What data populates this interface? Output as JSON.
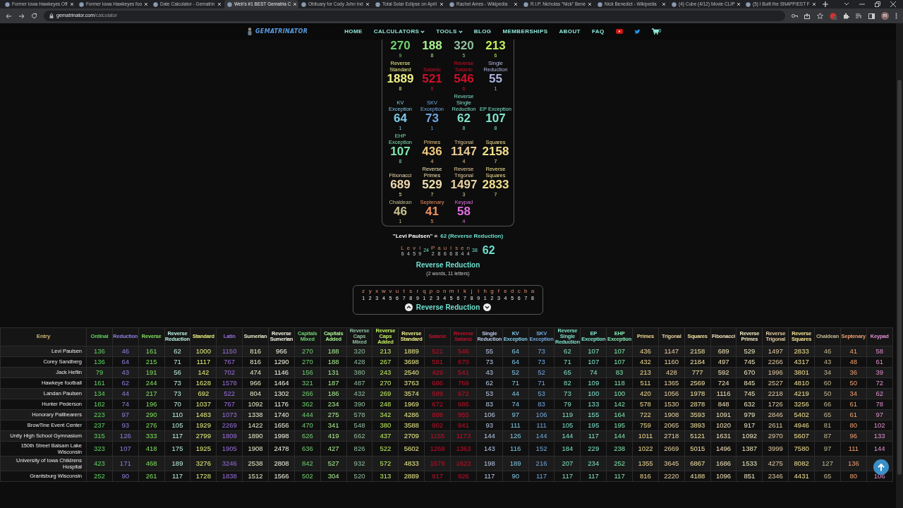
{
  "browser": {
    "tabs": [
      {
        "title": "Former Iowa Hawkeyes Off",
        "selected": false
      },
      {
        "title": "Former Iowa Hawkeyes foo",
        "selected": false
      },
      {
        "title": "Date Calculator - Gematrin",
        "selected": false
      },
      {
        "title": "Web's #1 BEST Gematria C",
        "selected": true
      },
      {
        "title": "Obituary for Cody John Ind",
        "selected": false
      },
      {
        "title": "Total Solar Eclipse on April",
        "selected": false
      },
      {
        "title": "Rachel Ames - Wikipedia",
        "selected": false
      },
      {
        "title": "R.I.P. Nicholas \"Nick\" Bene",
        "selected": false
      },
      {
        "title": "Nick Benedict - Wikipedia",
        "selected": false
      },
      {
        "title": "(4) Cube (4/12) Movie CLIP",
        "selected": false
      },
      {
        "title": "(5) I Built the SNAPPIEST F",
        "selected": false
      }
    ],
    "address_host": "gematrinator.com",
    "address_path": "/calculator",
    "profile_initial": "m"
  },
  "site_nav": {
    "logo": "GEMATRINATOR",
    "links": [
      {
        "label": "HOME",
        "dropdown": false
      },
      {
        "label": "CALCULATORS",
        "dropdown": true
      },
      {
        "label": "TOOLS",
        "dropdown": true
      },
      {
        "label": "BLOG",
        "dropdown": false
      },
      {
        "label": "MEMBERSHIPS",
        "dropdown": false
      },
      {
        "label": "ABOUT",
        "dropdown": false
      },
      {
        "label": "FAQ",
        "dropdown": false
      }
    ],
    "cart_count": "0"
  },
  "cipher_grid": {
    "rows": [
      [
        {
          "value": "270",
          "digit": "9",
          "color": "#6fcf6f"
        },
        {
          "value": "188",
          "digit": "8",
          "color": "#a8f08f"
        },
        {
          "value": "320",
          "digit": "5",
          "color": "#8fbf9f"
        },
        {
          "value": "213",
          "digit": "6",
          "color": "#c0f060"
        }
      ],
      [
        {
          "label": "Reverse Standard",
          "value": "1889",
          "digit": "8",
          "color": "#f0f08a"
        },
        {
          "label": "Satanic",
          "value": "521",
          "digit": "8",
          "color": "#d0102a"
        },
        {
          "label": "Reverse Satanic",
          "value": "546",
          "digit": "6",
          "color": "#d0102a"
        },
        {
          "label": "Single Reduction",
          "value": "55",
          "digit": "1",
          "color": "#b0b8e0"
        }
      ],
      [
        {
          "label": "KV Exception",
          "value": "64",
          "digit": "1",
          "color": "#7fc8e8"
        },
        {
          "label": "SKV Exception",
          "value": "73",
          "digit": "1",
          "color": "#6fa8e0"
        },
        {
          "label": "Reverse Single Reduction",
          "value": "62",
          "digit": "8",
          "color": "#7fe0c8"
        },
        {
          "label": "EP Exception",
          "value": "107",
          "digit": "8",
          "color": "#7fe8d0"
        }
      ],
      [
        {
          "label": "EHP Exception",
          "value": "107",
          "digit": "8",
          "color": "#7fe8b0"
        },
        {
          "label": "Primes",
          "value": "436",
          "digit": "4",
          "color": "#f0c880"
        },
        {
          "label": "Trigonal",
          "value": "1147",
          "digit": "4",
          "color": "#e8c898"
        },
        {
          "label": "Squares",
          "value": "2158",
          "digit": "7",
          "color": "#f0e090"
        }
      ],
      [
        {
          "label": "Fibonacci",
          "value": "689",
          "digit": "5",
          "color": "#f0d8b0"
        },
        {
          "label": "Reverse Primes",
          "value": "529",
          "digit": "7",
          "color": "#f0e0b0"
        },
        {
          "label": "Reverse Trigonal",
          "value": "1497",
          "digit": "3",
          "color": "#e8d0a0"
        },
        {
          "label": "Reverse Squares",
          "value": "2833",
          "digit": "7",
          "color": "#f0e090"
        }
      ],
      [
        {
          "label": "Chaldean",
          "value": "46",
          "digit": "1",
          "color": "#c8c090"
        },
        {
          "label": "Septenary",
          "value": "41",
          "digit": "5",
          "color": "#f09060"
        },
        {
          "label": "Keypad",
          "value": "58",
          "digit": "4",
          "color": "#e070e0"
        }
      ]
    ]
  },
  "summary": {
    "phrase": "\"Levi Paulsen\" =",
    "result": "62 (Reverse Reduction)",
    "words": [
      {
        "letters": [
          {
            "letter": "L",
            "value": "6"
          },
          {
            "letter": "e",
            "value": "4"
          },
          {
            "letter": "v",
            "value": "5"
          },
          {
            "letter": "i",
            "value": "9"
          }
        ],
        "total": "24"
      },
      {
        "letters": [
          {
            "letter": "P",
            "value": "2"
          },
          {
            "letter": "a",
            "value": "8"
          },
          {
            "letter": "u",
            "value": "6"
          },
          {
            "letter": "l",
            "value": "6"
          },
          {
            "letter": "s",
            "value": "8"
          },
          {
            "letter": "e",
            "value": "4"
          },
          {
            "letter": "n",
            "value": "4"
          }
        ],
        "total": "38"
      }
    ],
    "grand_total": "62",
    "cipher": "Reverse Reduction",
    "counts": "(2 words, 11 letters)"
  },
  "cipher_key": {
    "letters": [
      "z",
      "y",
      "x",
      "w",
      "v",
      "u",
      "t",
      "s",
      "r",
      "q",
      "p",
      "o",
      "n",
      "m",
      "l",
      "k",
      "j",
      "i",
      "h",
      "g",
      "f",
      "e",
      "d",
      "c",
      "b",
      "a"
    ],
    "numbers": [
      "1",
      "2",
      "3",
      "4",
      "5",
      "6",
      "7",
      "8",
      "9",
      "1",
      "2",
      "3",
      "4",
      "5",
      "6",
      "7",
      "8",
      "9",
      "1",
      "2",
      "3",
      "4",
      "5",
      "6",
      "7",
      "8"
    ],
    "label": "Reverse Reduction"
  },
  "table": {
    "columns": [
      {
        "label": "Entry",
        "color": "#c8b46e"
      },
      {
        "label": "Ordinal",
        "color": "#5fd35f"
      },
      {
        "label": "Reduction",
        "color": "#8f7fdf"
      },
      {
        "label": "Reverse",
        "color": "#7fe05f"
      },
      {
        "label": "Reverse Reduction",
        "color": "#b8f0e0"
      },
      {
        "label": "Standard",
        "color": "#e8f07a"
      },
      {
        "label": "Latin",
        "color": "#9a6fe0"
      },
      {
        "label": "Sumerian",
        "color": "#e8e8c8"
      },
      {
        "label": "Reverse Sumerian",
        "color": "#f4f4e4"
      },
      {
        "label": "Capitals Mixed",
        "color": "#6fcf6f"
      },
      {
        "label": "Capitals Added",
        "color": "#a8f08f"
      },
      {
        "label": "Reverse Caps Mixed",
        "color": "#8fbf9f"
      },
      {
        "label": "Reverse Caps Added",
        "color": "#c0f060"
      },
      {
        "label": "Reverse Standard",
        "color": "#f0f08a"
      },
      {
        "label": "Satanic",
        "color": "#c0102a"
      },
      {
        "label": "Reverse Satanic",
        "color": "#c0102a"
      },
      {
        "label": "Single Reduction",
        "color": "#b8c8e8"
      },
      {
        "label": "KV Exception",
        "color": "#7fc8e8"
      },
      {
        "label": "SKV Exception",
        "color": "#6fa8e0"
      },
      {
        "label": "Reverse Single Reduction",
        "color": "#7fe0c8"
      },
      {
        "label": "EP Exception",
        "color": "#7fe8d0"
      },
      {
        "label": "EHP Exception",
        "color": "#7fe8b0"
      },
      {
        "label": "Primes",
        "color": "#f0d890"
      },
      {
        "label": "Trigonal",
        "color": "#e8d0a0"
      },
      {
        "label": "Squares",
        "color": "#f0e0a0"
      },
      {
        "label": "Fibonacci",
        "color": "#f0e0b8"
      },
      {
        "label": "Reverse Primes",
        "color": "#f0e8c0"
      },
      {
        "label": "Reverse Trigonal",
        "color": "#e0c8a0"
      },
      {
        "label": "Reverse Squares",
        "color": "#f0e090"
      },
      {
        "label": "Chaldean",
        "color": "#c0b890"
      },
      {
        "label": "Septenary",
        "color": "#f0a070"
      },
      {
        "label": "Keypad",
        "color": "#e090d0"
      }
    ],
    "rows": [
      {
        "entry": "Levi Paulsen",
        "values": [
          "136",
          "46",
          "161",
          "62",
          "1000",
          "1150",
          "816",
          "966",
          "270",
          "188",
          "320",
          "213",
          "1889",
          "521",
          "546",
          "55",
          "64",
          "73",
          "62",
          "107",
          "107",
          "436",
          "1147",
          "2158",
          "689",
          "529",
          "1497",
          "2833",
          "46",
          "41",
          "58"
        ]
      },
      {
        "entry": "Corey Sandberg",
        "values": [
          "136",
          "64",
          "215",
          "71",
          "1117",
          "767",
          "816",
          "1290",
          "270",
          "188",
          "428",
          "267",
          "3698",
          "591",
          "670",
          "73",
          "64",
          "73",
          "71",
          "107",
          "107",
          "432",
          "1160",
          "2184",
          "497",
          "745",
          "2266",
          "4317",
          "43",
          "48",
          "61"
        ]
      },
      {
        "entry": "Jack Heflin",
        "values": [
          "79",
          "43",
          "191",
          "56",
          "142",
          "702",
          "474",
          "1146",
          "156",
          "131",
          "380",
          "243",
          "2540",
          "429",
          "541",
          "43",
          "52",
          "52",
          "65",
          "74",
          "83",
          "213",
          "428",
          "777",
          "592",
          "670",
          "1996",
          "3801",
          "34",
          "36",
          "39"
        ]
      },
      {
        "entry": "Hawkeye football",
        "values": [
          "161",
          "62",
          "244",
          "73",
          "1628",
          "1578",
          "966",
          "1464",
          "321",
          "187",
          "487",
          "270",
          "3763",
          "686",
          "769",
          "62",
          "71",
          "71",
          "82",
          "109",
          "118",
          "511",
          "1365",
          "2569",
          "724",
          "845",
          "2527",
          "4810",
          "60",
          "50",
          "72"
        ]
      },
      {
        "entry": "Landan Paulsen",
        "values": [
          "134",
          "44",
          "217",
          "73",
          "692",
          "522",
          "804",
          "1302",
          "266",
          "186",
          "432",
          "269",
          "3574",
          "589",
          "672",
          "53",
          "44",
          "53",
          "73",
          "100",
          "100",
          "420",
          "1056",
          "1978",
          "1116",
          "745",
          "2218",
          "4219",
          "50",
          "34",
          "62"
        ]
      },
      {
        "entry": "Hunter Pederson",
        "values": [
          "182",
          "74",
          "196",
          "70",
          "1037",
          "767",
          "1092",
          "1176",
          "362",
          "234",
          "390",
          "248",
          "1969",
          "672",
          "686",
          "83",
          "74",
          "83",
          "79",
          "133",
          "142",
          "578",
          "1530",
          "2878",
          "848",
          "632",
          "1726",
          "3256",
          "66",
          "61",
          "78"
        ]
      },
      {
        "entry": "Honorary Pallbearers",
        "values": [
          "223",
          "97",
          "290",
          "110",
          "1483",
          "1073",
          "1338",
          "1740",
          "444",
          "275",
          "578",
          "342",
          "4286",
          "888",
          "955",
          "106",
          "97",
          "106",
          "119",
          "155",
          "164",
          "722",
          "1908",
          "3593",
          "1091",
          "979",
          "2846",
          "5402",
          "65",
          "61",
          "97"
        ]
      },
      {
        "entry": "BrowTine Event Center",
        "values": [
          "237",
          "93",
          "276",
          "105",
          "1929",
          "2269",
          "1422",
          "1656",
          "470",
          "341",
          "548",
          "380",
          "3588",
          "902",
          "941",
          "93",
          "111",
          "111",
          "105",
          "195",
          "195",
          "759",
          "2065",
          "3893",
          "1020",
          "917",
          "2611",
          "4946",
          "81",
          "80",
          "102"
        ]
      },
      {
        "entry": "Unity High School Gymnasium",
        "values": [
          "315",
          "126",
          "333",
          "117",
          "2799",
          "1809",
          "1890",
          "1998",
          "626",
          "419",
          "662",
          "437",
          "2709",
          "1155",
          "1173",
          "144",
          "126",
          "144",
          "144",
          "117",
          "144",
          "1011",
          "2718",
          "5121",
          "1631",
          "1092",
          "2970",
          "5607",
          "87",
          "96",
          "133"
        ]
      },
      {
        "entry": "150th Street Balsam Lake Wisconsin",
        "values": [
          "323",
          "107",
          "418",
          "175",
          "1925",
          "1905",
          "1908",
          "2478",
          "636",
          "427",
          "826",
          "522",
          "5602",
          "1268",
          "1363",
          "143",
          "116",
          "152",
          "184",
          "229",
          "238",
          "1022",
          "2669",
          "5015",
          "1496",
          "1387",
          "3999",
          "7580",
          "97",
          "111",
          "144"
        ]
      },
      {
        "entry": "University of Iowa Childrens Hospital",
        "values": [
          "423",
          "171",
          "468",
          "189",
          "3276",
          "3246",
          "2538",
          "2808",
          "842",
          "527",
          "932",
          "572",
          "4833",
          "1578",
          "1623",
          "198",
          "189",
          "216",
          "207",
          "234",
          "252",
          "1355",
          "3645",
          "6867",
          "1686",
          "1533",
          "4275",
          "8082",
          "127",
          "136"
        ]
      },
      {
        "entry": "Grantsburg Wisconsin",
        "values": [
          "252",
          "90",
          "261",
          "117",
          "1728",
          "1838",
          "1512",
          "1566",
          "502",
          "304",
          "520",
          "313",
          "2889",
          "917",
          "926",
          "117",
          "90",
          "117",
          "117",
          "117",
          "117",
          "816",
          "2220",
          "4188",
          "1096",
          "851",
          "2346",
          "4431",
          "65",
          "80",
          "106"
        ]
      }
    ]
  }
}
